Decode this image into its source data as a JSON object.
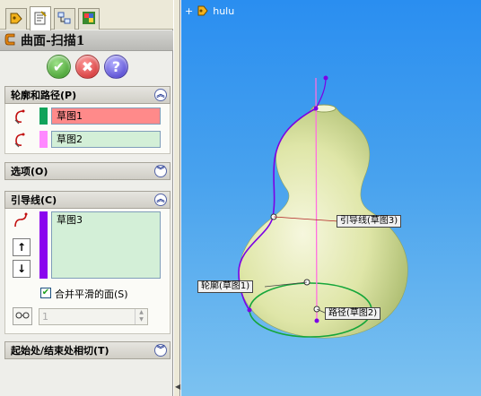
{
  "feature_title": "曲面-扫描1",
  "tabs": [
    "feature-manager",
    "property-manager",
    "configuration-manager",
    "display-manager"
  ],
  "sections": {
    "profile_path": {
      "title": "轮廓和路径(P)",
      "profile": {
        "value": "草图1",
        "color": "#ff8a8a",
        "swatch": "#11a35a"
      },
      "path": {
        "value": "草图2",
        "color": "#d3efd7",
        "swatch": "#ff88ff"
      }
    },
    "options": {
      "title": "选项(O)"
    },
    "guide_curves": {
      "title": "引导线(C)",
      "items": [
        "草图3"
      ],
      "swatch": "#8a05ee",
      "merge_label": "合并平滑的面(S)",
      "merge_checked": true,
      "spin_value": "1"
    },
    "tangency": {
      "title": "起始处/结束处相切(T)"
    }
  },
  "viewport": {
    "tree_node": "hulu",
    "callouts": {
      "guide": "引导线(草图3)",
      "profile": "轮廓(草图1)",
      "path": "路径(草图2)"
    }
  }
}
